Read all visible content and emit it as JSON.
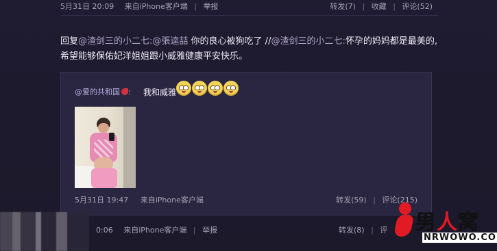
{
  "top_post": {
    "time": "5月31日 20:09",
    "source": "来自iPhone客户端",
    "report": "举报",
    "actions": {
      "repost": "转发(7)",
      "fav": "收藏",
      "comment": "评论(52)"
    }
  },
  "reply": {
    "prefix": "回复",
    "mention1": "@渣剑三的小二七:",
    "mention2": "@張逵喆",
    "text1": " 你的良心被狗吃了 //",
    "mention3": "@渣剑三的小二七:",
    "text2": "怀孕的妈妈都是最美的,希望能够保佑妃洋姐姐跟小威雅健康平安快乐。"
  },
  "quote": {
    "author": "@爱的共和国",
    "text": "我和威雅",
    "emojis": [
      "blush-emoji",
      "blush-emoji",
      "blush-emoji",
      "blush-emoji"
    ],
    "time": "5月31日 19:47",
    "source": "来自iPhone客户端",
    "actions": {
      "repost": "转发(59)",
      "comment": "评论(215)"
    }
  },
  "bottom_post": {
    "time_fragment": "0:06",
    "source": "来自iPhone客户端",
    "report": "举报",
    "actions": {
      "repost": "转发(8)",
      "comment_fragment": "评"
    }
  },
  "watermark": {
    "cn_left": "男",
    "cn_red": "人",
    "cn_right": "窝",
    "url": "NRWOWO.COM"
  }
}
